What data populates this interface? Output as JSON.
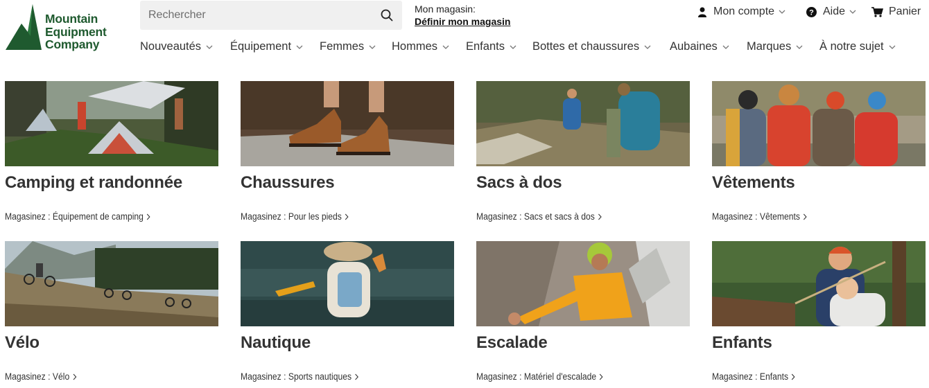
{
  "brand": {
    "name_lines": [
      "Mountain",
      "Equipment",
      "Company"
    ],
    "color": "#1f5a2f"
  },
  "search": {
    "placeholder": "Rechercher",
    "value": "",
    "icon": "search-icon"
  },
  "store": {
    "label": "Mon magasin:",
    "link": "Définir mon magasin"
  },
  "utility": {
    "account": {
      "label": "Mon compte",
      "icon": "user-icon"
    },
    "help": {
      "label": "Aide",
      "icon": "help-circle-icon"
    },
    "cart": {
      "label": "Panier",
      "icon": "cart-icon"
    }
  },
  "nav": {
    "items": [
      {
        "label": "Nouveautés"
      },
      {
        "label": "Équipement"
      },
      {
        "label": "Femmes"
      },
      {
        "label": "Hommes"
      },
      {
        "label": "Enfants"
      },
      {
        "label": "Bottes et chaussures"
      },
      {
        "label": "Aubaines"
      },
      {
        "label": "Marques"
      },
      {
        "label": "À notre sujet"
      }
    ]
  },
  "categories": [
    {
      "title": "Camping et randonnée",
      "shop": "Magasinez : Équipement de camping",
      "photo": "tents at campsite"
    },
    {
      "title": "Chaussures",
      "shop": "Magasinez : Pour les pieds",
      "photo": "hiking boots on rock"
    },
    {
      "title": "Sacs à dos",
      "shop": "Magasinez : Sacs et sacs à dos",
      "photo": "hikers with backpacks"
    },
    {
      "title": "Vêtements",
      "shop": "Magasinez : Vêtements",
      "photo": "group wearing jackets"
    },
    {
      "title": "Vélo",
      "shop": "Magasinez : Vélo",
      "photo": "mountain bikers on slope"
    },
    {
      "title": "Nautique",
      "shop": "Magasinez : Sports nautiques",
      "photo": "paddler in canoe"
    },
    {
      "title": "Escalade",
      "shop": "Magasinez : Matériel d'escalade",
      "photo": "climber on rock face"
    },
    {
      "title": "Enfants",
      "shop": "Magasinez : Enfants",
      "photo": "kids in forest"
    }
  ]
}
